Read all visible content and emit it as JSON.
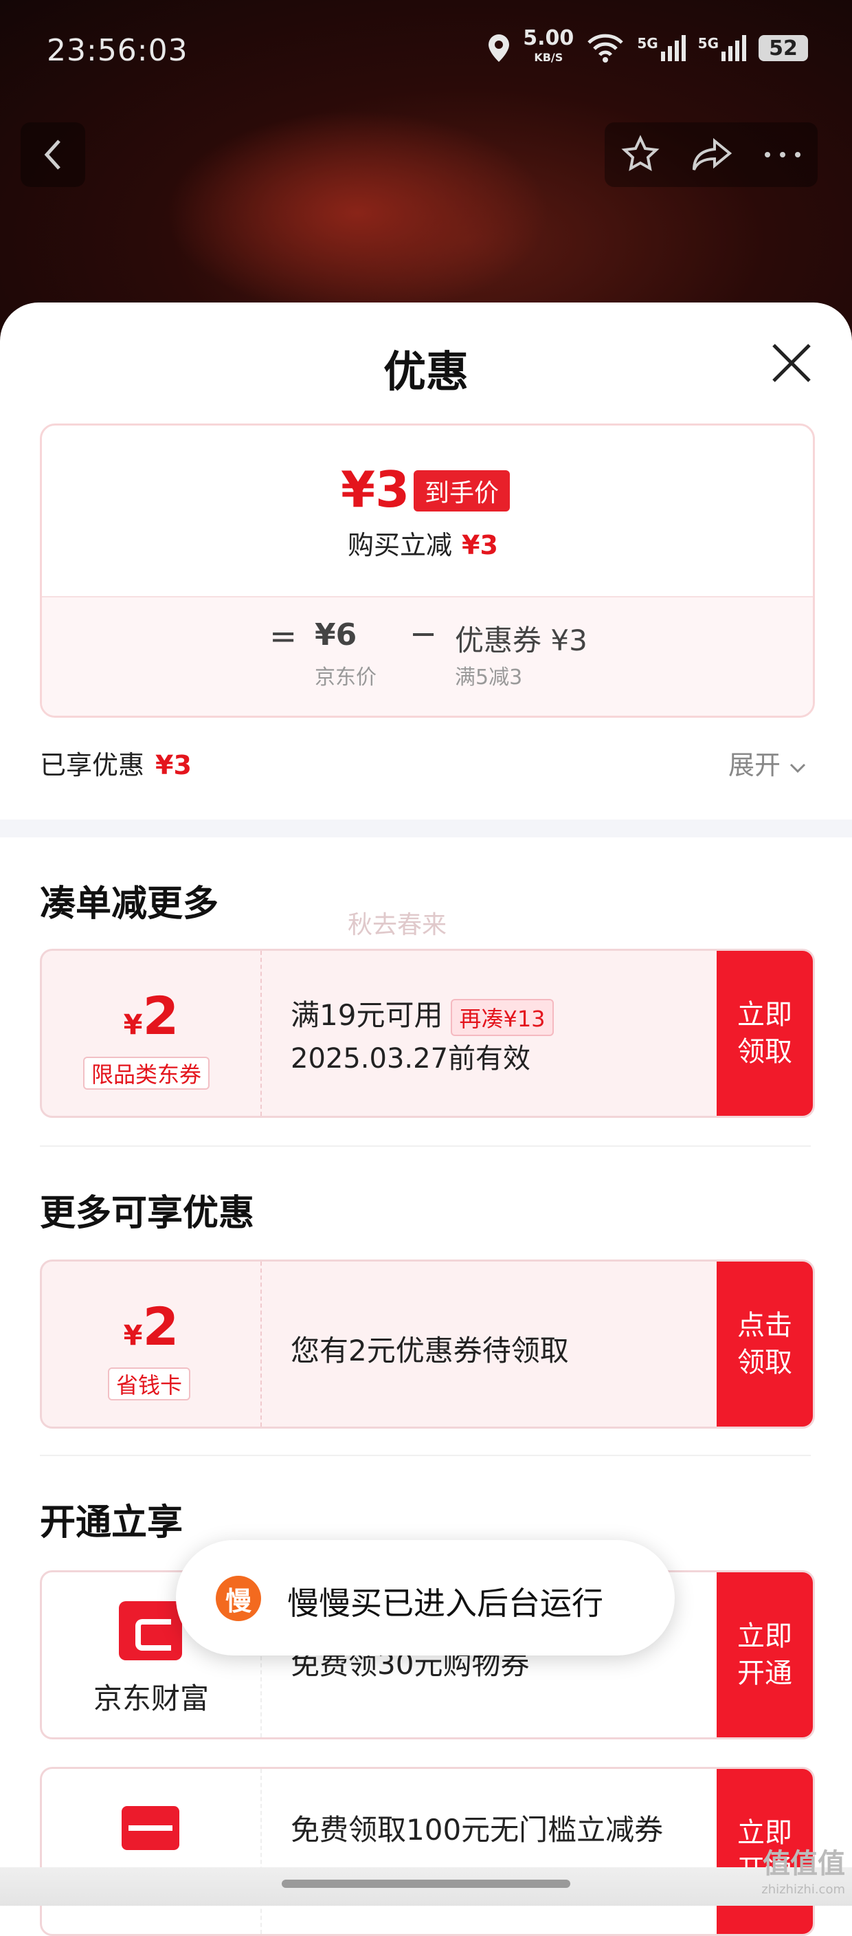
{
  "status_bar": {
    "time": "23:56:03",
    "net_speed": "5.00",
    "net_unit": "KB/S",
    "signal1": "5G",
    "signal2": "5G",
    "battery": "52"
  },
  "sheet": {
    "title": "优惠"
  },
  "price_card": {
    "final_price": "¥3",
    "final_tag": "到手价",
    "reduce_label": "购买立减",
    "reduce_value": "¥3",
    "eq": "=",
    "jd_price": "¥6",
    "jd_label": "京东价",
    "minus": "−",
    "coupon_price": "优惠券 ¥3",
    "coupon_rule": "满5减3"
  },
  "enjoyed": {
    "label": "已享优惠",
    "value": "¥3",
    "expand": "展开"
  },
  "watermark": "秋去春来",
  "section1": {
    "title": "凑单减更多",
    "coupon": {
      "amount": "2",
      "yen": "¥",
      "type": "限品类东券",
      "line1": "满19元可用",
      "add_tag": "再凑¥13",
      "line2": "2025.03.27前有效",
      "action": "立即领取"
    }
  },
  "section2": {
    "title": "更多可享优惠",
    "coupon": {
      "amount": "2",
      "yen": "¥",
      "type": "省钱卡",
      "line1": "您有2元优惠券待领取",
      "action": "点击领取"
    }
  },
  "section3": {
    "title": "开通立享",
    "items": [
      {
        "name": "京东财富",
        "line1": "免费领30元购物券",
        "action": "立即开通"
      },
      {
        "name": "",
        "line1": "免费领取100元无门槛立减券",
        "action": "立即开通"
      }
    ]
  },
  "toast": {
    "icon": "慢",
    "text": "慢慢买已进入后台运行"
  },
  "corner_watermark": {
    "text": "值值值",
    "sub": "zhizhizhi.com"
  },
  "colors": {
    "accent": "#e4151d",
    "action_bg": "#f11a2a",
    "toast_icon": "#f36a1f"
  }
}
